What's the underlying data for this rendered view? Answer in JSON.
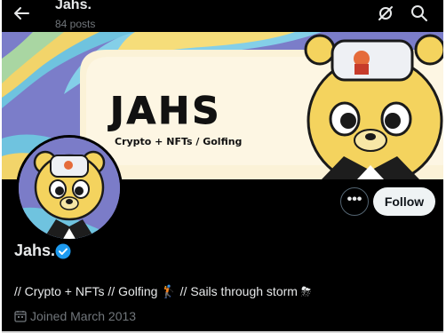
{
  "header": {
    "title": "Jahs.",
    "posts_count": "84 posts",
    "back_icon": "arrow-left-icon",
    "notify_icon": "notification-off-icon",
    "search_icon": "search-icon"
  },
  "banner": {
    "title": "JAHS",
    "tagline": "Crypto + NFTs / Golfing"
  },
  "actions": {
    "more_label": "•••",
    "follow_label": "Follow"
  },
  "profile": {
    "display_name": "Jahs.",
    "verified": true,
    "bio_text": "// Crypto + NFTs // Golfing 🏌 // Sails through storm ⛈",
    "joined": "Joined March 2013"
  },
  "colors": {
    "background": "#000000",
    "text_primary": "#e7e9ea",
    "text_secondary": "#71767b",
    "verified_blue": "#1d9bf0",
    "follow_bg": "#eff3f4"
  }
}
